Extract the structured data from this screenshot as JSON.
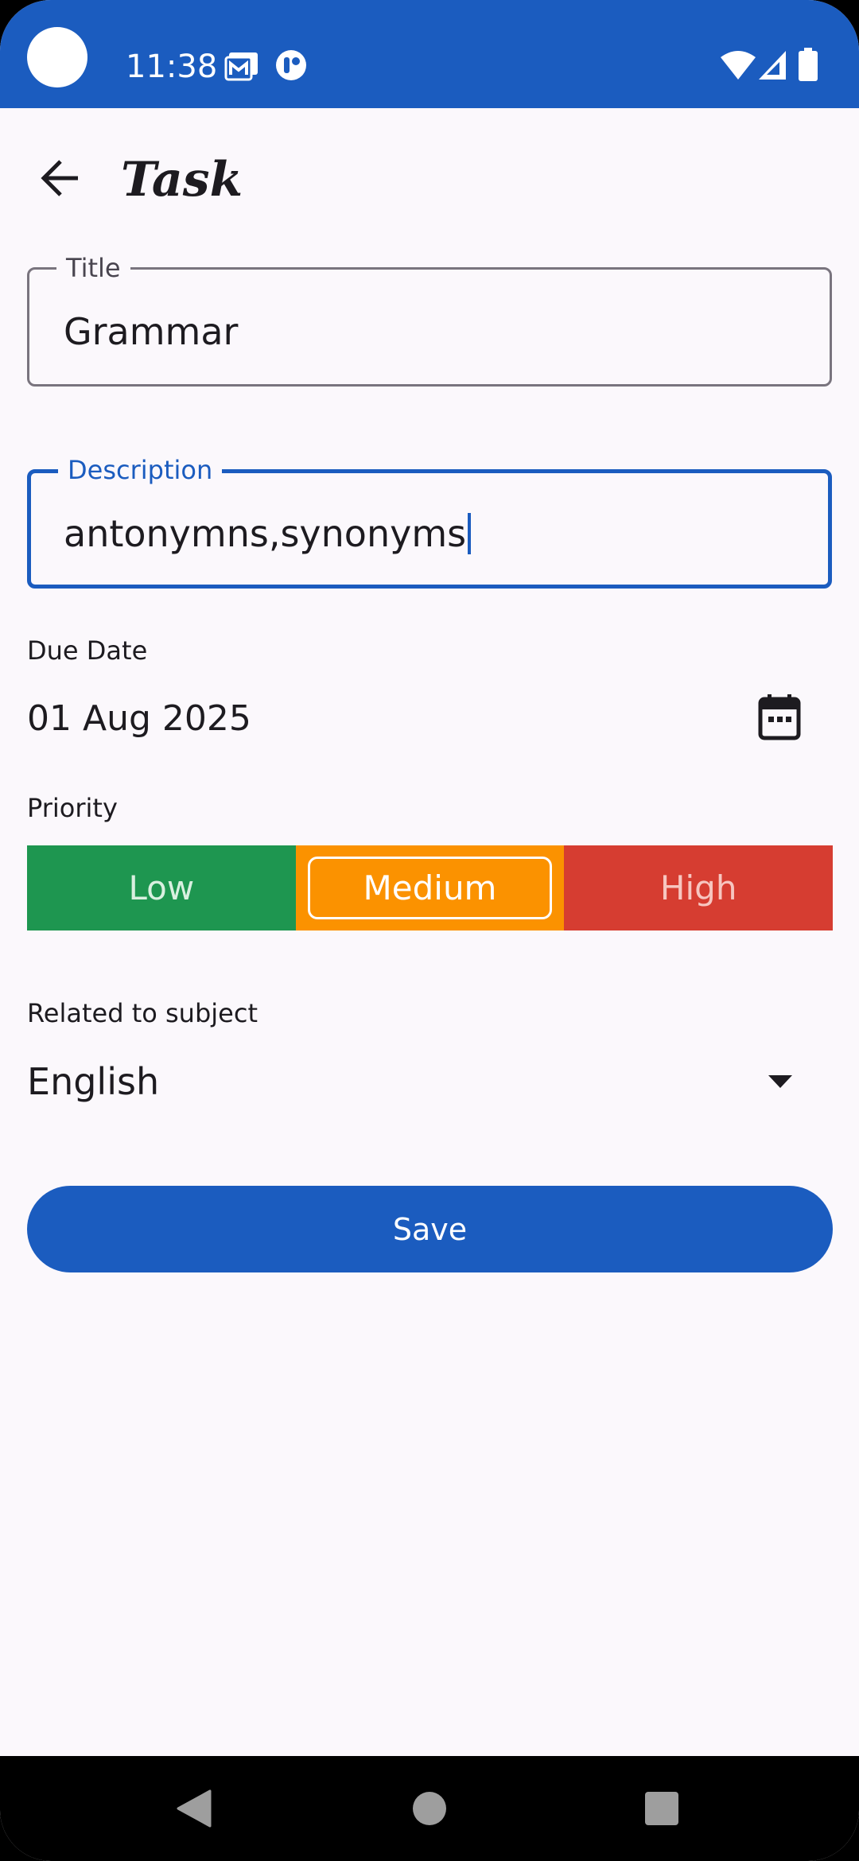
{
  "status_bar": {
    "time": "11:38",
    "icons": [
      "gmail-icon",
      "app-notification-icon",
      "wifi-icon",
      "signal-icon",
      "battery-icon"
    ]
  },
  "app_bar": {
    "title": "Task",
    "back_icon": "arrow-back-icon"
  },
  "form": {
    "title_field": {
      "label": "Title",
      "value": "Grammar"
    },
    "description_field": {
      "label": "Description",
      "value": "antonymns,synonyms",
      "focused": true
    },
    "due_date": {
      "label": "Due Date",
      "value": "01 Aug 2025",
      "icon": "calendar-icon"
    },
    "priority": {
      "label": "Priority",
      "options": [
        {
          "label": "Low",
          "color": "#1e9650"
        },
        {
          "label": "Medium",
          "color": "#fb9200"
        },
        {
          "label": "High",
          "color": "#d63d31"
        }
      ],
      "selected": "Medium"
    },
    "subject": {
      "label": "Related to subject",
      "value": "English",
      "icon": "dropdown-arrow-icon"
    },
    "save_label": "Save"
  },
  "nav_bar": {
    "buttons": [
      "back-triangle-icon",
      "home-circle-icon",
      "recents-square-icon"
    ]
  },
  "colors": {
    "primary": "#1b5cbf",
    "background": "#fbf8fc",
    "outline": "#79747e"
  }
}
